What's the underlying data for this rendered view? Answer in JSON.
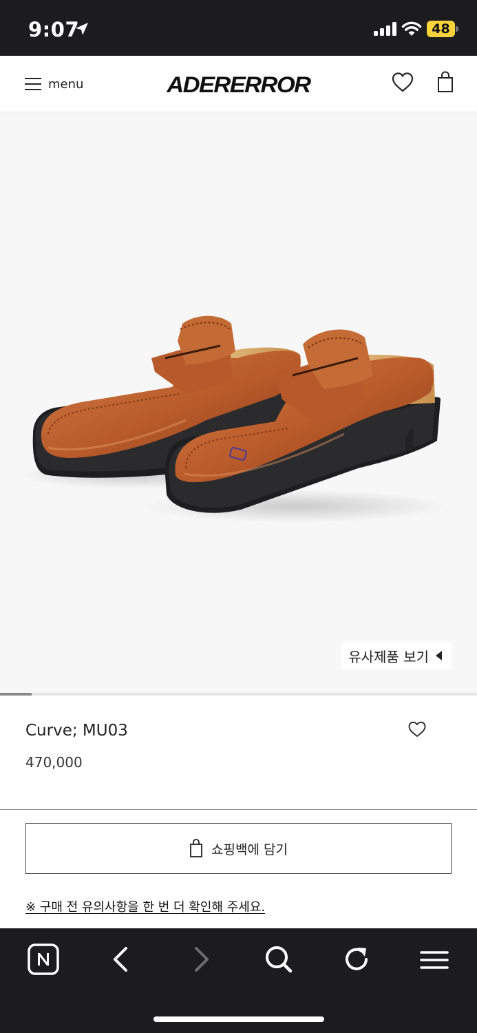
{
  "status_bar": {
    "time": "9:07",
    "battery_level": "48",
    "icons": [
      "location-arrow-icon",
      "cellular-signal-icon",
      "wifi-icon",
      "battery-icon"
    ],
    "battery_color": "#f7d23a"
  },
  "header": {
    "menu_label": "menu",
    "logo_text": "ADERERROR",
    "icons": [
      "hamburger-icon",
      "heart-icon",
      "shopping-bag-icon"
    ]
  },
  "gallery": {
    "similar_products_label": "유사제품 보기",
    "background": "#f7f7f7",
    "slide_progress": 0.067
  },
  "product": {
    "name": "Curve; MU03",
    "price": "470,000",
    "shoe_color": "#b85a2a"
  },
  "actions": {
    "add_to_bag_label": "쇼핑백에 담기",
    "notice_link": "※ 구매 전 유의사항을 한 번 더 확인해 주세요."
  },
  "browser_toolbar": {
    "buttons": [
      "naver-home-icon",
      "back-icon",
      "forward-icon",
      "search-icon",
      "reload-icon",
      "menu-icon"
    ]
  }
}
